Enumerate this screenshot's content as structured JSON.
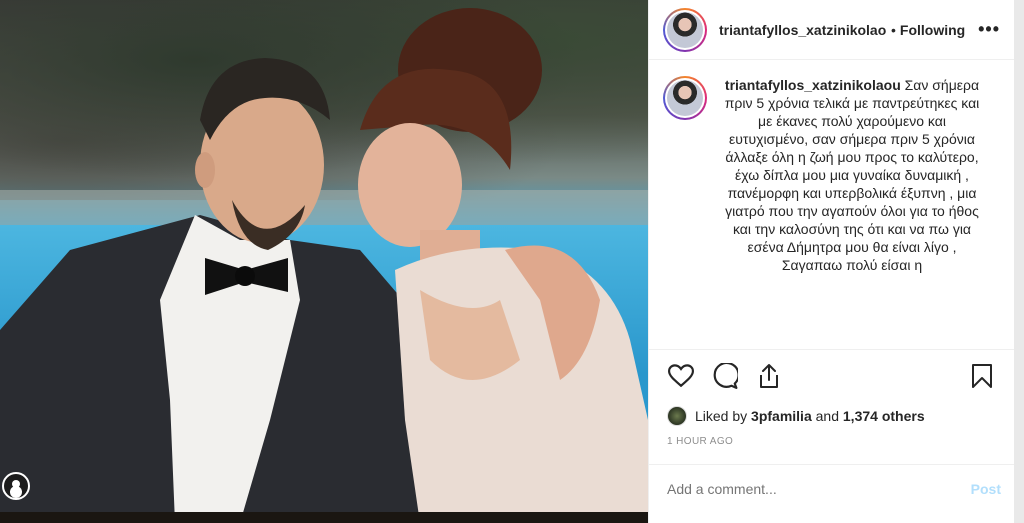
{
  "header": {
    "username": "triantafyllos_xatzinikolaou",
    "separator": "•",
    "follow_state": "Following",
    "more_label": "•••"
  },
  "caption": {
    "username": "triantafyllos_xatzinikolaou",
    "text": "Σαν σήμερα πριν 5 χρόνια τελικά με παντρεύτηκες και με έκανες πολύ χαρούμενο και ευτυχισμένο, σαν σήμερα πριν 5 χρόνια άλλαξε όλη η ζωή μου προς το καλύτερο, έχω δίπλα μου μια γυναίκα δυναμική , πανέμορφη και υπερβολικά έξυπνη , μια γιατρό που την αγαπούν όλοι για το ήθος και την καλοσύνη της ότι και να πω για εσένα Δήμητρα μου θα είναι λίγο , Σαγαπαω πολύ είσαι η"
  },
  "icons": {
    "like": "heart-icon",
    "comment": "comment-icon",
    "share": "share-icon",
    "save": "bookmark-icon",
    "post_menu": "more-icon"
  },
  "likes": {
    "prefix": "Liked by",
    "user": "3pfamilia",
    "middle": "and",
    "others": "1,374 others"
  },
  "timestamp": "1 HOUR AGO",
  "comment_box": {
    "placeholder": "Add a comment...",
    "post_label": "Post"
  },
  "colors": {
    "post_disabled": "#b2dffc",
    "meta_gray": "#8e8e8e",
    "text": "#262626"
  }
}
